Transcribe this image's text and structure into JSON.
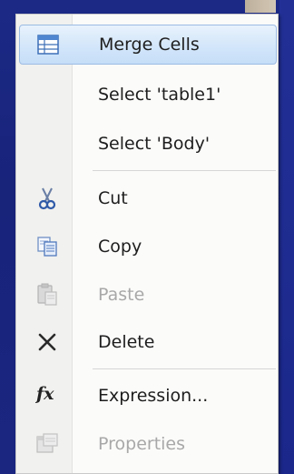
{
  "context_menu": {
    "items": [
      {
        "label": "Merge Cells",
        "icon": "merge-cells-icon",
        "enabled": true,
        "highlighted": true
      },
      {
        "label": "Select 'table1'",
        "icon": null,
        "enabled": true
      },
      {
        "label": "Select 'Body'",
        "icon": null,
        "enabled": true
      },
      {
        "label": "Cut",
        "icon": "scissors-icon",
        "enabled": true
      },
      {
        "label": "Copy",
        "icon": "copy-icon",
        "enabled": true
      },
      {
        "label": "Paste",
        "icon": "paste-icon",
        "enabled": false
      },
      {
        "label": "Delete",
        "icon": "delete-x-icon",
        "enabled": true
      },
      {
        "label": "Expression...",
        "icon": "fx-icon",
        "enabled": true
      },
      {
        "label": "Properties",
        "icon": "properties-icon",
        "enabled": false
      }
    ],
    "colors": {
      "highlight_fill": "#d3e6fa",
      "highlight_border": "#9cbbe3",
      "disabled_text": "#a8a8a8",
      "text": "#1e1e1e"
    }
  }
}
